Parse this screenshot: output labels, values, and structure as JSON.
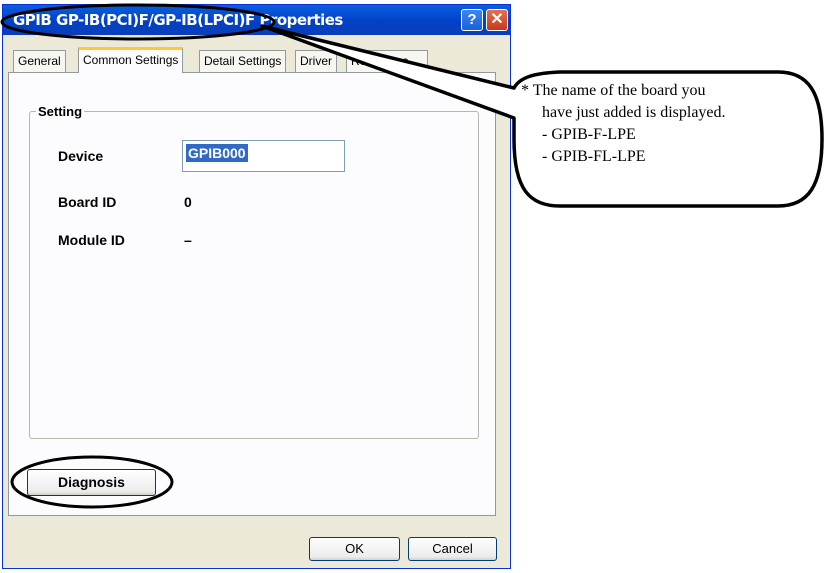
{
  "window": {
    "title": "GPIB GP-IB(PCI)F/GP-IB(LPCI)F Properties",
    "help_icon": "?",
    "close_icon": "✕"
  },
  "tabs": [
    {
      "label": "General",
      "active": false
    },
    {
      "label": "Common Settings",
      "active": true
    },
    {
      "label": "Detail Settings",
      "active": false
    },
    {
      "label": "Driver",
      "active": false
    },
    {
      "label": "Resources",
      "active": false
    }
  ],
  "group": {
    "legend": "Setting",
    "device_label": "Device",
    "device_value": "GPIB000",
    "board_id_label": "Board ID",
    "board_id_value": "0",
    "module_id_label": "Module ID",
    "module_id_value": "–"
  },
  "buttons": {
    "diagnosis": "Diagnosis",
    "ok": "OK",
    "cancel": "Cancel"
  },
  "callout": {
    "line1": "* The name of the board you",
    "line2": "have just added is displayed.",
    "line3": "- GPIB-F-LPE",
    "line4": "- GPIB-FL-LPE"
  }
}
